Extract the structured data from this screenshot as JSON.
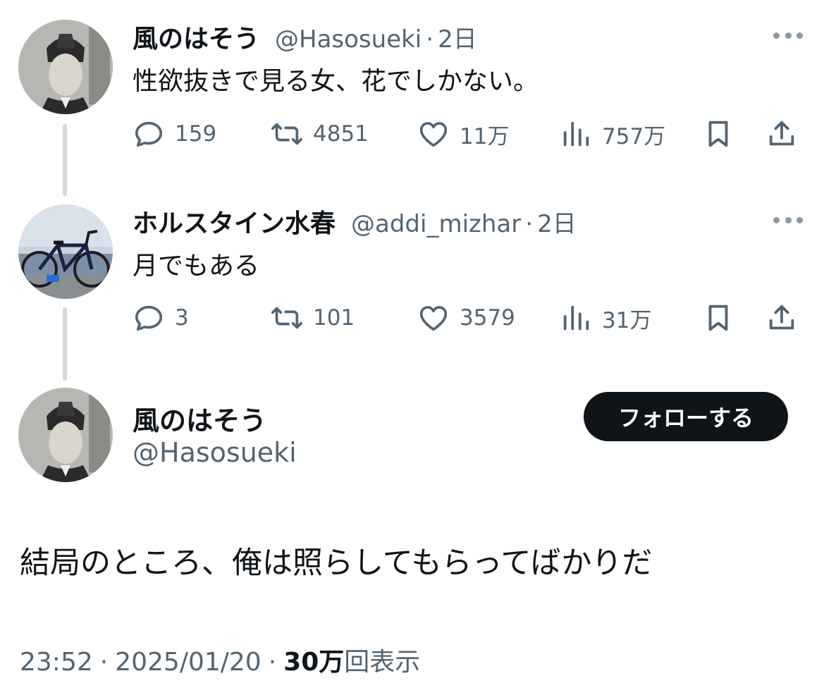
{
  "colors": {
    "text_primary": "#0f1419",
    "text_secondary": "#536471",
    "thread_line": "#cfd9de",
    "follow_bg": "#0f1419",
    "follow_text": "#ffffff"
  },
  "tweets": [
    {
      "display_name": "風のはそう",
      "handle": "@Hasosueki",
      "separator": "·",
      "time": "2日",
      "text": "性欲抜きで見る女、花でしかない。",
      "replies": "159",
      "retweets": "4851",
      "likes": "11万",
      "views": "757万"
    },
    {
      "display_name": "ホルスタイン水春",
      "handle": "@addi_mizhar",
      "separator": "·",
      "time": "2日",
      "text": "月でもある",
      "replies": "3",
      "retweets": "101",
      "likes": "3579",
      "views": "31万"
    }
  ],
  "main_tweet": {
    "display_name": "風のはそう",
    "handle": "@Hasosueki",
    "follow_label": "フォローする",
    "text": "結局のところ、俺は照らしてもらってばかりだ",
    "time": "23:52",
    "separator": "·",
    "date": "2025/01/20",
    "views_count": "30万",
    "views_suffix": "回表示"
  },
  "icons": {
    "reply": "reply-icon",
    "retweet": "retweet-icon",
    "like": "heart-icon",
    "views": "views-chart-icon",
    "bookmark": "bookmark-icon",
    "share": "share-icon",
    "more": "more-icon"
  }
}
